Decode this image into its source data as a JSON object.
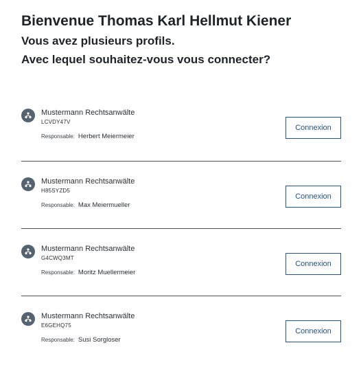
{
  "header": {
    "title": "Bienvenue Thomas Karl Hellmut Kiener",
    "line1": "Vous avez plusieurs profils.",
    "line2": "Avec lequel souhaitez-vous vous connecter?"
  },
  "profiles": [
    {
      "company": "Mustermann Rechtsanwälte",
      "code": "LCVDY47V",
      "responsible_label": "Responsable:",
      "responsible": "Herbert Meiermeier",
      "button": "Connexion"
    },
    {
      "company": "Mustermann Rechtsanwälte",
      "code": "H85SYZD5",
      "responsible_label": "Responsable:",
      "responsible": "Max Meiermueller",
      "button": "Connexion"
    },
    {
      "company": "Mustermann Rechtsanwälte",
      "code": "G4CWQ3MT",
      "responsible_label": "Responsable:",
      "responsible": "Moritz Muellermeier",
      "button": "Connexion"
    },
    {
      "company": "Mustermann Rechtsanwälte",
      "code": "E6GEHQ75",
      "responsible_label": "Responsable:",
      "responsible": "Susi Sorgloser",
      "button": "Connexion"
    }
  ],
  "icons": {
    "avatar": "organization-icon"
  },
  "colors": {
    "accent": "#24528a",
    "avatar_bg": "#556270",
    "divider": "#4a4f55",
    "text": "#1f2328"
  }
}
